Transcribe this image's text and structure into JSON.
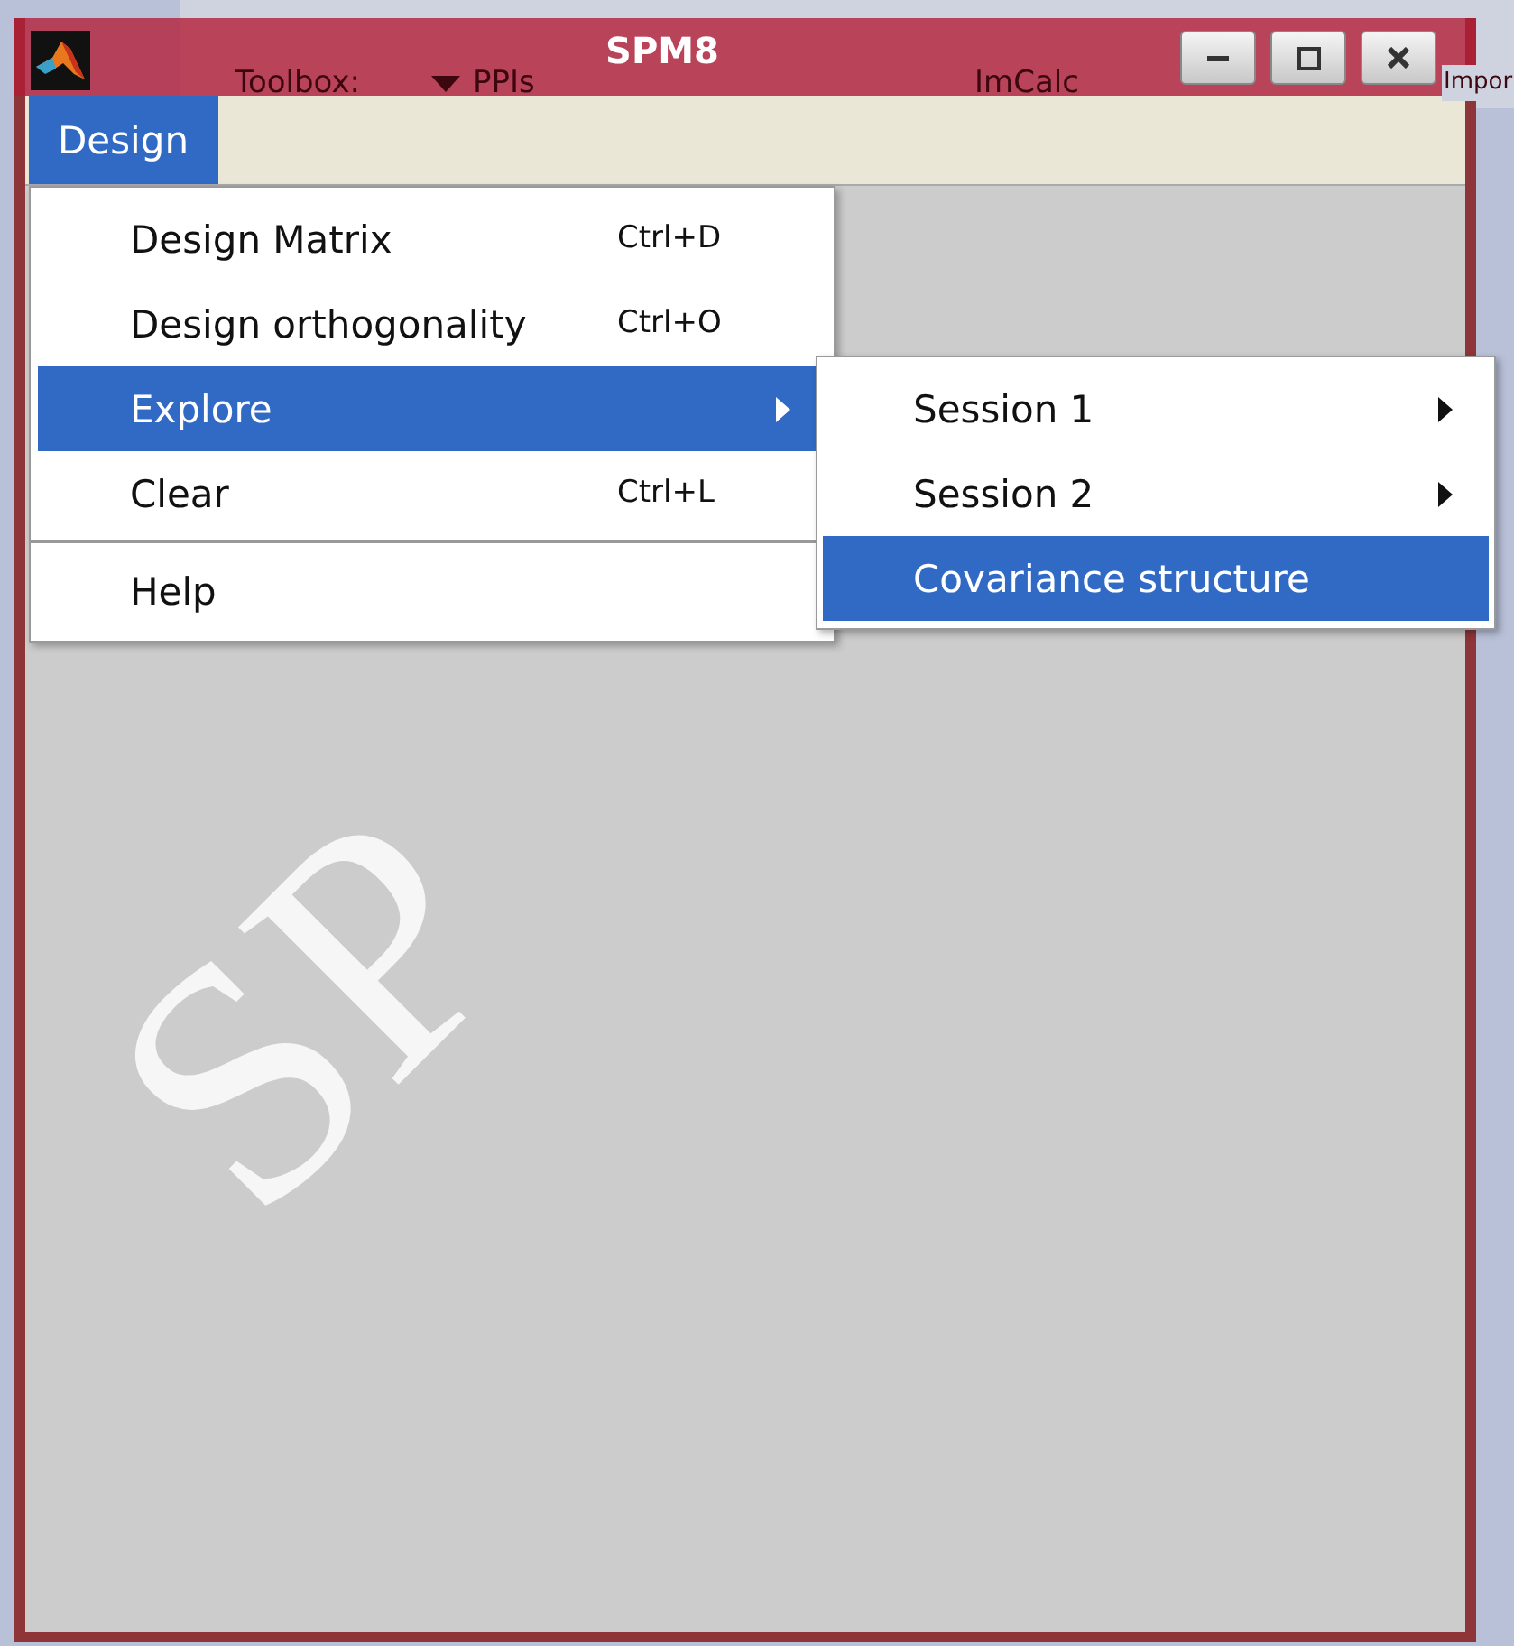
{
  "background_window": {
    "controls": [
      {
        "kind": "dropdown",
        "label": "Toolbox:"
      },
      {
        "kind": "button",
        "label": "PPIs"
      },
      {
        "kind": "button",
        "label": "ImCalc"
      },
      {
        "kind": "button",
        "label": "Impor"
      }
    ]
  },
  "window": {
    "title": "SPM8",
    "buttons": [
      {
        "kind": "minimize"
      },
      {
        "kind": "maximize"
      },
      {
        "kind": "close"
      }
    ]
  },
  "menubar": [
    {
      "label": "Design",
      "selected": true
    }
  ],
  "menu": [
    {
      "kind": "item",
      "label": "Design Matrix",
      "shortcut": "Ctrl+D",
      "selected": false
    },
    {
      "kind": "item",
      "label": "Design orthogonality",
      "shortcut": "Ctrl+O",
      "selected": false
    },
    {
      "kind": "submenu",
      "label": "Explore",
      "selected": true
    },
    {
      "kind": "item",
      "label": "Clear",
      "shortcut": "Ctrl+L",
      "selected": false
    },
    {
      "kind": "separator"
    },
    {
      "kind": "item",
      "label": "Help",
      "selected": false
    }
  ],
  "submenu": [
    {
      "kind": "submenu",
      "label": "Session 1",
      "selected": false
    },
    {
      "kind": "submenu",
      "label": "Session 2",
      "selected": false
    },
    {
      "kind": "item",
      "label": "Covariance structure",
      "selected": true
    }
  ],
  "content": {
    "logo_text": "SP"
  }
}
